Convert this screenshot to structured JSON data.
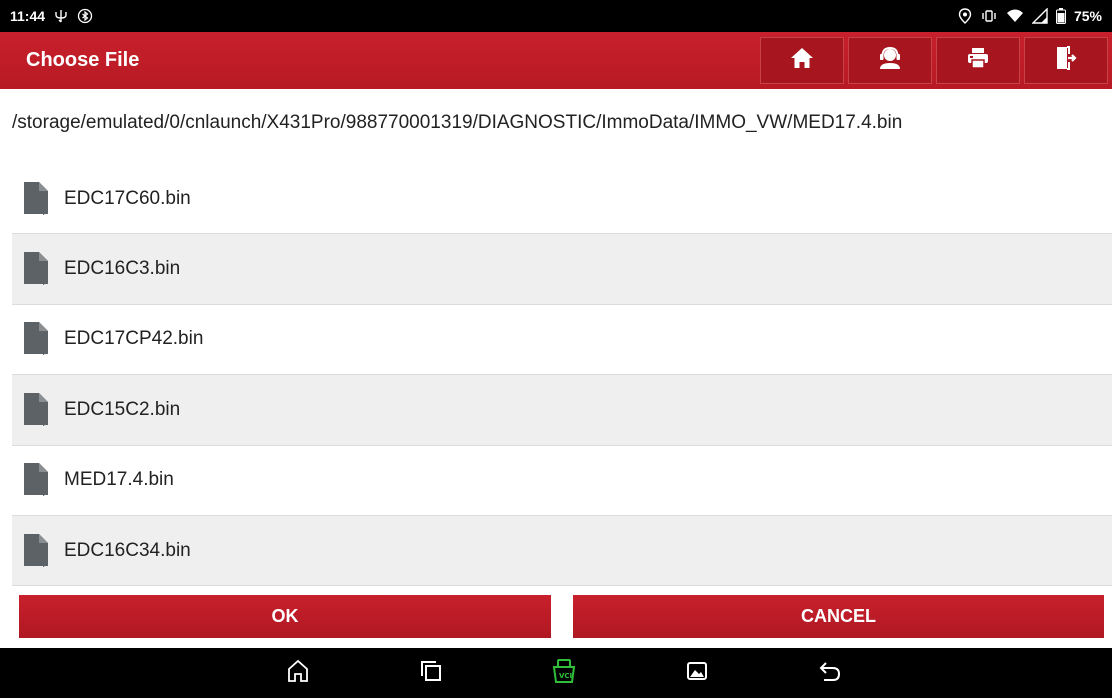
{
  "status_bar": {
    "time": "11:44",
    "battery": "75%",
    "left_icons": [
      "usb-debug-icon",
      "bluetooth-icon"
    ],
    "right_icons": [
      "location-icon",
      "vibrate-icon",
      "wifi-icon",
      "signal-icon",
      "battery-icon"
    ]
  },
  "header": {
    "title": "Choose File",
    "toolbar": [
      "home-icon",
      "support-agent-icon",
      "print-icon",
      "exit-icon"
    ]
  },
  "path": "/storage/emulated/0/cnlaunch/X431Pro/988770001319/DIAGNOSTIC/ImmoData/IMMO_VW/MED17.4.bin",
  "files": [
    {
      "name": "EDC17C60.bin"
    },
    {
      "name": "EDC16C3.bin"
    },
    {
      "name": "EDC17CP42.bin"
    },
    {
      "name": "EDC15C2.bin"
    },
    {
      "name": "MED17.4.bin"
    },
    {
      "name": "EDC16C34.bin"
    }
  ],
  "buttons": {
    "ok": "OK",
    "cancel": "CANCEL"
  },
  "nav_bar": [
    "home-icon",
    "recents-icon",
    "vci-icon",
    "gallery-icon",
    "back-icon"
  ],
  "colors": {
    "accent": "#c21e29",
    "vci": "#2fbf3a"
  }
}
